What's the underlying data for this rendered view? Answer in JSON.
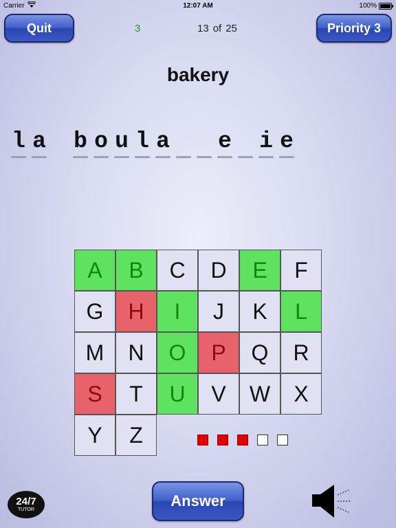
{
  "status_bar": {
    "carrier": "Carrier",
    "time": "12:07 AM",
    "battery": "100%",
    "wifi_icon": "wifi-icon",
    "battery_icon": "battery-icon"
  },
  "header": {
    "quit_label": "Quit",
    "score": "3",
    "progress_current": "13",
    "progress_of": "of",
    "progress_total": "25",
    "priority_label": "Priority 3"
  },
  "word": "bakery",
  "puzzle": [
    "l",
    "a",
    " ",
    "b",
    "o",
    "u",
    "l",
    "a",
    "",
    "",
    "e",
    "",
    "i",
    "e"
  ],
  "letters": [
    {
      "ch": "A",
      "state": "correct"
    },
    {
      "ch": "B",
      "state": "correct"
    },
    {
      "ch": "C",
      "state": "unused"
    },
    {
      "ch": "D",
      "state": "unused"
    },
    {
      "ch": "E",
      "state": "correct"
    },
    {
      "ch": "F",
      "state": "unused"
    },
    {
      "ch": "G",
      "state": "unused"
    },
    {
      "ch": "H",
      "state": "wrong"
    },
    {
      "ch": "I",
      "state": "correct"
    },
    {
      "ch": "J",
      "state": "unused"
    },
    {
      "ch": "K",
      "state": "unused"
    },
    {
      "ch": "L",
      "state": "correct"
    },
    {
      "ch": "M",
      "state": "unused"
    },
    {
      "ch": "N",
      "state": "unused"
    },
    {
      "ch": "O",
      "state": "correct"
    },
    {
      "ch": "P",
      "state": "wrong"
    },
    {
      "ch": "Q",
      "state": "unused"
    },
    {
      "ch": "R",
      "state": "unused"
    },
    {
      "ch": "S",
      "state": "wrong"
    },
    {
      "ch": "T",
      "state": "unused"
    },
    {
      "ch": "U",
      "state": "correct"
    },
    {
      "ch": "V",
      "state": "unused"
    },
    {
      "ch": "W",
      "state": "unused"
    },
    {
      "ch": "X",
      "state": "unused"
    },
    {
      "ch": "Y",
      "state": "unused"
    },
    {
      "ch": "Z",
      "state": "unused"
    }
  ],
  "mistakes": {
    "used": 3,
    "total": 5,
    "used_color": "#e00000"
  },
  "footer": {
    "logo_line1": "24/7",
    "logo_line2": "TUTOR",
    "answer_label": "Answer",
    "speaker_icon": "speaker-icon"
  },
  "colors": {
    "correct": "#5fe25f",
    "wrong": "#e8626c",
    "button": "#3f5fcb",
    "score": "#1a9a1a"
  }
}
